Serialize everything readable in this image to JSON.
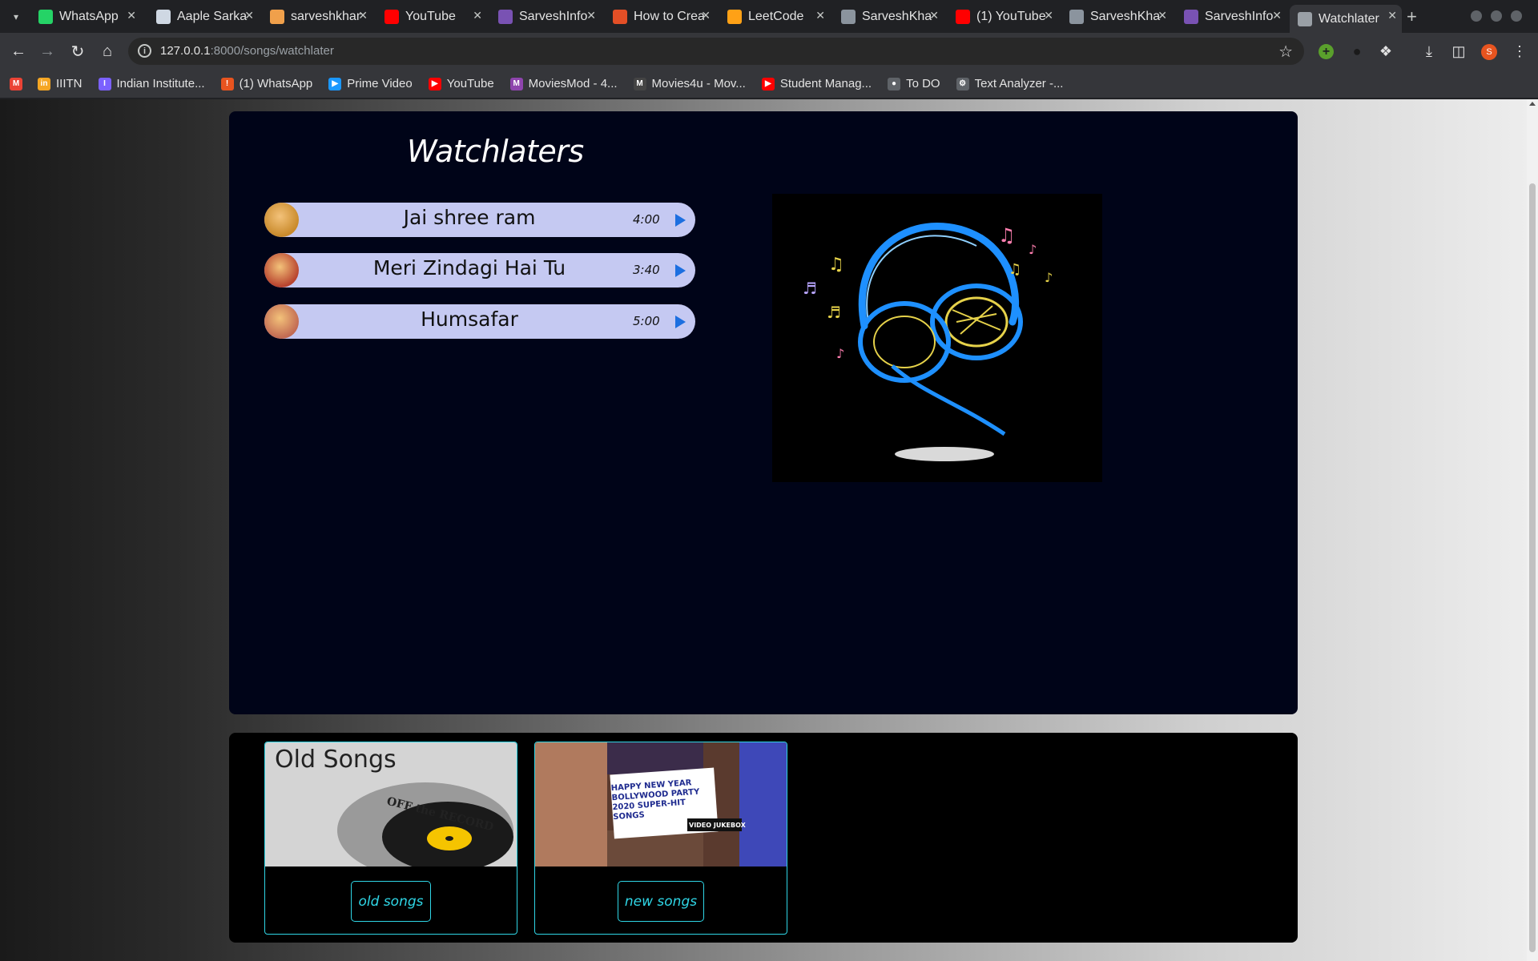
{
  "browser": {
    "tabs": [
      {
        "title": "WhatsApp",
        "icon": "whatsapp-icon",
        "color": "#25d366"
      },
      {
        "title": "Aaple Sarkar",
        "icon": "docs-icon",
        "color": "#cfd8e3"
      },
      {
        "title": "sarveshkhandalkar",
        "icon": "amazon-icon",
        "color": "#f0a04b"
      },
      {
        "title": "YouTube",
        "icon": "youtube-icon",
        "color": "#ff0000"
      },
      {
        "title": "SarveshInfo",
        "icon": "bootstrap-icon",
        "color": "#7952b3"
      },
      {
        "title": "How to Create",
        "icon": "html5-icon",
        "color": "#e34f26"
      },
      {
        "title": "LeetCode",
        "icon": "leetcode-icon",
        "color": "#ffa116"
      },
      {
        "title": "SarveshKhandalkar",
        "icon": "github-icon",
        "color": "#8b949e"
      },
      {
        "title": "(1) YouTube",
        "icon": "youtube-icon",
        "color": "#ff0000"
      },
      {
        "title": "SarveshKhandalkar",
        "icon": "github-icon",
        "color": "#8b949e"
      },
      {
        "title": "SarveshInfo",
        "icon": "bootstrap-icon",
        "color": "#7952b3"
      },
      {
        "title": "Watchlater",
        "icon": "globe-icon",
        "color": "#9aa0a6"
      }
    ],
    "url_host": "127.0.0.1",
    "url_rest": ":8000/songs/watchlater",
    "profile_initial": "S",
    "bookmarks": [
      {
        "label": "",
        "icon": "gmail-icon",
        "color": "#ea4335",
        "glyph": "M"
      },
      {
        "label": "IIITN",
        "icon": "iiitn-icon",
        "color": "#f5a623",
        "glyph": "in"
      },
      {
        "label": "Indian Institute...",
        "icon": "institute-icon",
        "color": "#7b61ff",
        "glyph": "I"
      },
      {
        "label": "(1) WhatsApp",
        "icon": "whatsapp-icon",
        "color": "#e8541f",
        "glyph": "!"
      },
      {
        "label": "Prime Video",
        "icon": "prime-video-icon",
        "color": "#1a98ff",
        "glyph": "▶"
      },
      {
        "label": "YouTube",
        "icon": "youtube-icon",
        "color": "#ff0000",
        "glyph": "▶"
      },
      {
        "label": "MoviesMod - 4...",
        "icon": "moviesmod-icon",
        "color": "#8e44ad",
        "glyph": "M"
      },
      {
        "label": "Movies4u - Mov...",
        "icon": "movies4u-icon",
        "color": "#444444",
        "glyph": "M"
      },
      {
        "label": "Student Manag...",
        "icon": "youtube-icon",
        "color": "#ff0000",
        "glyph": "▶"
      },
      {
        "label": "To DO",
        "icon": "globe-icon",
        "color": "#5f6368",
        "glyph": "●"
      },
      {
        "label": "Text Analyzer -...",
        "icon": "gear-icon",
        "color": "#5f6368",
        "glyph": "⚙"
      }
    ]
  },
  "page": {
    "title": "Watchlaters",
    "songs": [
      {
        "name": "Jai shree ram",
        "duration": "4:00",
        "thumb_color": "#c98a2b"
      },
      {
        "name": "Meri Zindagi Hai Tu",
        "duration": "3:40",
        "thumb_color": "#b8432e"
      },
      {
        "name": "Humsafar",
        "duration": "5:00",
        "thumb_color": "#c26a52"
      }
    ],
    "categories": [
      {
        "image_text": "Old Songs",
        "image_sub": "OFF the RECORD",
        "button": "old songs"
      },
      {
        "image_text": "HAPPY NEW YEAR BOLLYWOOD PARTY 2020 SUPER-HIT SONGS",
        "image_sub": "VIDEO JUKEBOX",
        "button": "new songs"
      }
    ]
  },
  "colors": {
    "accent_cyan": "#2fd6e6",
    "song_pill": "#c5c9f2",
    "panel": "#000418"
  }
}
